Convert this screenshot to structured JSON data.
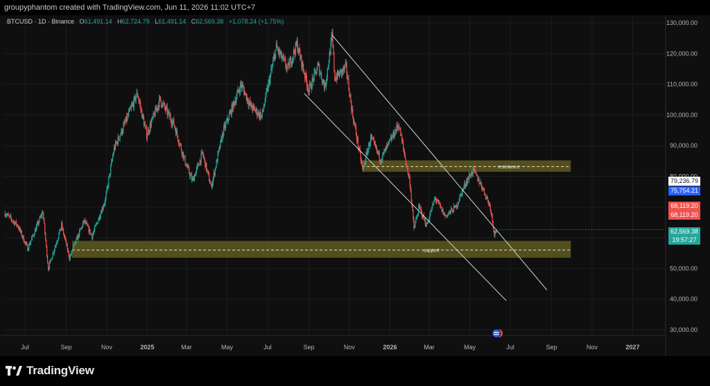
{
  "header": {
    "attribution": "groupyphantom created with TradingView.com, Jun 11, 2026 11:02 UTC+7"
  },
  "legend": {
    "symbol": "BTCUSD · 1D · Binance",
    "o_key": "O",
    "o": "61,491.14",
    "h_key": "H",
    "h": "62,724.79",
    "l_key": "L",
    "l": "61,491.14",
    "c_key": "C",
    "c": "62,569.38",
    "change": "+1,078.24 (+1.75%)"
  },
  "brand": {
    "logo_text": "TradingView",
    "logo_icon": "tradingview-logo-icon"
  },
  "labels": {
    "last_price": "79,236.79",
    "blue_price": "75,754.21",
    "red_price_1": "68,119.20",
    "red_price_2": "68,119.20",
    "current_price": "62,569.38",
    "countdown": "19:57:27"
  },
  "colors": {
    "up": "#26a69a",
    "down": "#ef5350",
    "zone": "#6b6420",
    "blue": "#2962ff",
    "background": "#0f0f10"
  },
  "chart_data": {
    "type": "candlestick",
    "symbol": "BTCUSD",
    "interval": "1D",
    "exchange": "Binance",
    "ylim": [
      26000,
      134000
    ],
    "y_ticks": [
      30000,
      40000,
      50000,
      60000,
      70000,
      80000,
      90000,
      100000,
      110000,
      120000,
      130000
    ],
    "y_tick_labels": [
      "30,000.00",
      "40,000.00",
      "50,000.00",
      "60,000.00",
      "70,000.00",
      "80,000.00",
      "90,000.00",
      "100,000.00",
      "110,000.00",
      "120,000.00",
      "130,000.00"
    ],
    "x_tick_labels": [
      "Jul",
      "Sep",
      "Nov",
      "2025",
      "Mar",
      "May",
      "Jul",
      "Sep",
      "Nov",
      "2026",
      "Mar",
      "May",
      "Jul",
      "Sep",
      "Nov",
      "2027"
    ],
    "x_tick_dates": [
      "2024-07-01",
      "2024-09-01",
      "2024-11-01",
      "2025-01-01",
      "2025-03-01",
      "2025-05-01",
      "2025-07-01",
      "2025-09-01",
      "2025-11-01",
      "2026-01-01",
      "2026-03-01",
      "2026-05-01",
      "2026-07-01",
      "2026-09-01",
      "2026-11-01",
      "2027-01-01"
    ],
    "price_path": [
      [
        "2024-06-01",
        68000
      ],
      [
        "2024-06-20",
        64000
      ],
      [
        "2024-07-05",
        56500
      ],
      [
        "2024-07-28",
        68500
      ],
      [
        "2024-08-05",
        50000
      ],
      [
        "2024-08-25",
        64000
      ],
      [
        "2024-09-06",
        53500
      ],
      [
        "2024-09-28",
        65500
      ],
      [
        "2024-10-10",
        60500
      ],
      [
        "2024-10-30",
        72500
      ],
      [
        "2024-11-12",
        89000
      ],
      [
        "2024-11-25",
        95500
      ],
      [
        "2024-12-17",
        107000
      ],
      [
        "2024-12-31",
        93500
      ],
      [
        "2025-01-20",
        105000
      ],
      [
        "2025-02-10",
        97000
      ],
      [
        "2025-02-28",
        84000
      ],
      [
        "2025-03-10",
        78500
      ],
      [
        "2025-03-25",
        87500
      ],
      [
        "2025-04-07",
        76500
      ],
      [
        "2025-04-25",
        94500
      ],
      [
        "2025-05-22",
        110000
      ],
      [
        "2025-06-05",
        103000
      ],
      [
        "2025-06-22",
        99500
      ],
      [
        "2025-07-14",
        122000
      ],
      [
        "2025-07-31",
        115000
      ],
      [
        "2025-08-14",
        123000
      ],
      [
        "2025-09-01",
        108000
      ],
      [
        "2025-09-15",
        116000
      ],
      [
        "2025-09-25",
        109000
      ],
      [
        "2025-10-06",
        125500
      ],
      [
        "2025-10-10",
        112000
      ],
      [
        "2025-10-27",
        115500
      ],
      [
        "2025-11-05",
        101000
      ],
      [
        "2025-11-21",
        82000
      ],
      [
        "2025-12-03",
        92500
      ],
      [
        "2025-12-18",
        85500
      ],
      [
        "2026-01-05",
        93000
      ],
      [
        "2026-01-14",
        97000
      ],
      [
        "2026-01-31",
        78000
      ],
      [
        "2026-02-06",
        63000
      ],
      [
        "2026-02-14",
        70000
      ],
      [
        "2026-02-25",
        64000
      ],
      [
        "2026-03-10",
        73000
      ],
      [
        "2026-03-25",
        67000
      ],
      [
        "2026-04-10",
        70000
      ],
      [
        "2026-04-25",
        78000
      ],
      [
        "2026-05-06",
        82000
      ],
      [
        "2026-05-20",
        76500
      ],
      [
        "2026-06-01",
        70000
      ],
      [
        "2026-06-07",
        61200
      ],
      [
        "2026-06-10",
        62569
      ]
    ],
    "current_price": 62569.38,
    "zones": [
      {
        "name": "support",
        "label": "support",
        "from": "2024-09-10",
        "to": "2026-09-30",
        "low": 53500,
        "high": 59000,
        "mid": 56000
      },
      {
        "name": "resistance",
        "label": "resistance",
        "from": "2025-11-20",
        "to": "2026-09-30",
        "low": 81500,
        "high": 85200,
        "mid": 83200
      }
    ],
    "channel_lines": [
      {
        "from": [
          "2025-10-06",
          126000
        ],
        "to": [
          "2026-08-25",
          43000
        ]
      },
      {
        "from": [
          "2025-08-25",
          107000
        ],
        "to": [
          "2026-06-25",
          39500
        ]
      }
    ]
  }
}
